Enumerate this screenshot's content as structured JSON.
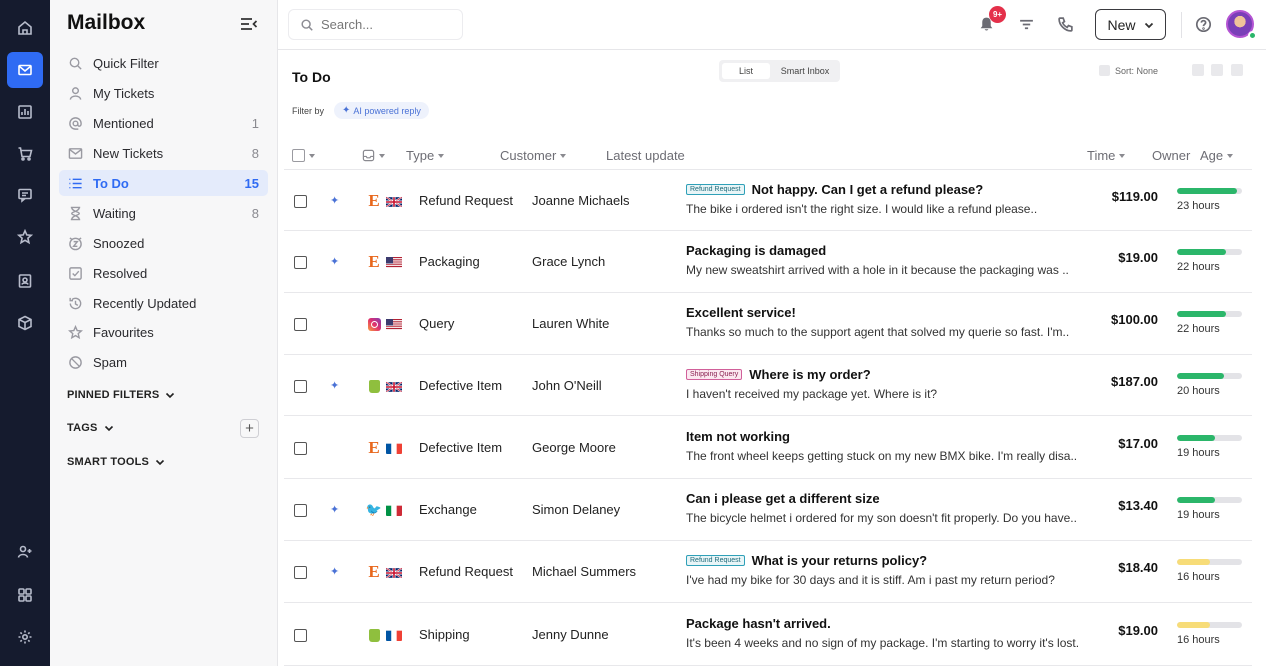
{
  "sidebar": {
    "title": "Mailbox",
    "items": [
      {
        "label": "Quick Filter",
        "count": "",
        "icon": "search-icon"
      },
      {
        "label": "My Tickets",
        "count": "",
        "icon": "user-icon"
      },
      {
        "label": "Mentioned",
        "count": "1",
        "icon": "at-icon"
      },
      {
        "label": "New Tickets",
        "count": "8",
        "icon": "mail-icon"
      },
      {
        "label": "To Do",
        "count": "15",
        "icon": "list-icon"
      },
      {
        "label": "Waiting",
        "count": "8",
        "icon": "hourglass-icon"
      },
      {
        "label": "Snoozed",
        "count": "",
        "icon": "snooze-icon"
      },
      {
        "label": "Resolved",
        "count": "",
        "icon": "check-square-icon"
      },
      {
        "label": "Recently Updated",
        "count": "",
        "icon": "history-icon"
      },
      {
        "label": "Favourites",
        "count": "",
        "icon": "star-icon"
      },
      {
        "label": "Spam",
        "count": "",
        "icon": "ban-icon"
      }
    ],
    "sections": {
      "pinned": "PINNED FILTERS",
      "tags": "TAGS",
      "smart": "SMART TOOLS"
    },
    "active_color": "#2f6bf3"
  },
  "topbar": {
    "search_placeholder": "Search...",
    "notification_badge": "9+",
    "new_label": "New"
  },
  "main": {
    "title": "To Do",
    "view_options": [
      "List",
      "Smart Inbox"
    ],
    "sort_label": "Sort: None",
    "filter_by": "Filter by",
    "ai_chip": "AI powered reply",
    "columns": {
      "type": "Type",
      "customer": "Customer",
      "latest": "Latest update",
      "time": "Time",
      "owner": "Owner",
      "age": "Age"
    },
    "rows": [
      {
        "ai": true,
        "source": "etsy",
        "flag": "gb",
        "type": "Refund Request",
        "customer": "Joanne Michaels",
        "tag": "Refund Request",
        "tag_kind": "refund",
        "subject": "Not happy. Can I get a refund please?",
        "preview": "The bike i ordered isn't the right size. I would like a refund please..",
        "price": "$119.00",
        "progress": 0.92,
        "bar_color": "#2bb66a",
        "age": "23 hours"
      },
      {
        "ai": true,
        "source": "etsy",
        "flag": "us",
        "type": "Packaging",
        "customer": "Grace Lynch",
        "tag": "",
        "tag_kind": "",
        "subject": "Packaging is damaged",
        "preview": "My new sweatshirt arrived with a hole in it because the packaging was ..",
        "price": "$19.00",
        "progress": 0.75,
        "bar_color": "#2bb66a",
        "age": "22 hours"
      },
      {
        "ai": false,
        "source": "instagram",
        "flag": "us",
        "type": "Query",
        "customer": "Lauren White",
        "tag": "",
        "tag_kind": "",
        "subject": "Excellent service!",
        "preview": "Thanks so much to the support agent that solved my querie so fast. I'm..",
        "price": "$100.00",
        "progress": 0.75,
        "bar_color": "#2bb66a",
        "age": "22 hours"
      },
      {
        "ai": true,
        "source": "shopify",
        "flag": "gb",
        "type": "Defective Item",
        "customer": "John O'Neill",
        "tag": "Shipping Query",
        "tag_kind": "ship",
        "subject": "Where is my order?",
        "preview": "I haven't received my package yet. Where is it?",
        "price": "$187.00",
        "progress": 0.72,
        "bar_color": "#2bb66a",
        "age": "20 hours"
      },
      {
        "ai": false,
        "source": "etsy",
        "flag": "fr",
        "type": "Defective Item",
        "customer": "George Moore",
        "tag": "",
        "tag_kind": "",
        "subject": "Item not working",
        "preview": "The front wheel keeps getting stuck on my new BMX bike. I'm really disa..",
        "price": "$17.00",
        "progress": 0.58,
        "bar_color": "#2bb66a",
        "age": "19 hours"
      },
      {
        "ai": true,
        "source": "twitter",
        "flag": "it",
        "type": "Exchange",
        "customer": "Simon Delaney",
        "tag": "",
        "tag_kind": "",
        "subject": "Can i please get a different size",
        "preview": "The bicycle helmet i ordered for my son doesn't fit properly. Do you have..",
        "price": "$13.40",
        "progress": 0.58,
        "bar_color": "#2bb66a",
        "age": "19 hours"
      },
      {
        "ai": true,
        "source": "etsy",
        "flag": "gb",
        "type": "Refund Request",
        "customer": "Michael Summers",
        "tag": "Refund Request",
        "tag_kind": "refund",
        "subject": "What is your returns policy?",
        "preview": "I've had my bike for 30 days and it is stiff. Am i past my return period?",
        "price": "$18.40",
        "progress": 0.5,
        "bar_color": "#f7dc78",
        "age": "16 hours"
      },
      {
        "ai": false,
        "source": "shopify",
        "flag": "fr",
        "type": "Shipping",
        "customer": "Jenny Dunne",
        "tag": "",
        "tag_kind": "",
        "subject": "Package hasn't arrived.",
        "preview": "It's been 4 weeks and no sign of my package. I'm starting to worry it's lost..",
        "price": "$19.00",
        "progress": 0.5,
        "bar_color": "#f7dc78",
        "age": "16 hours"
      }
    ]
  }
}
